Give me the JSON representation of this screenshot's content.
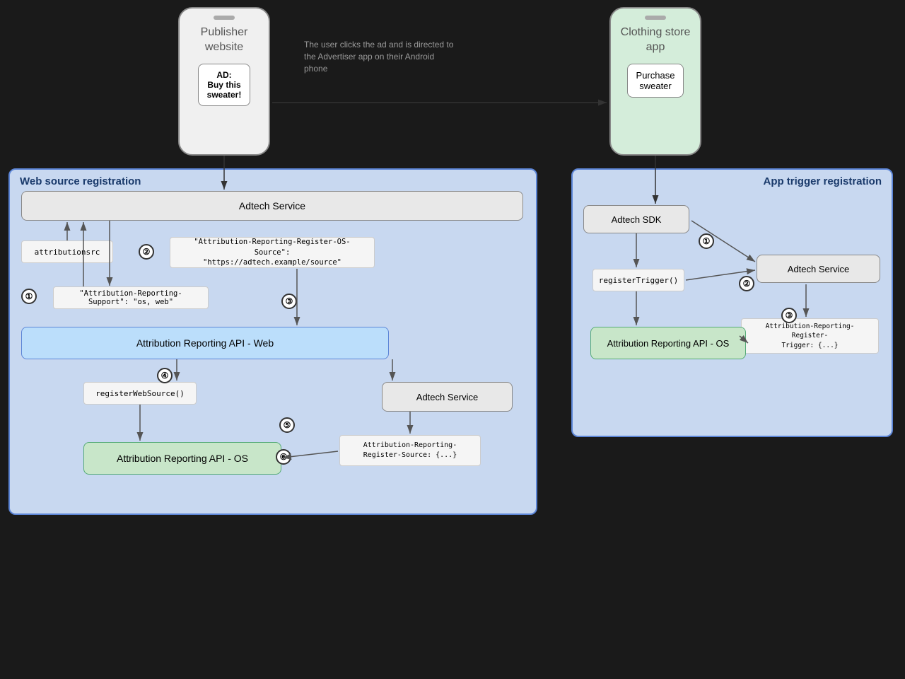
{
  "publisher_phone": {
    "title": "Publisher\nwebsite",
    "ad_label": "AD:",
    "ad_text": "Buy this\nsweater!"
  },
  "clothing_phone": {
    "title": "Clothing store\napp",
    "button": "Purchase\nsweater"
  },
  "caption": {
    "text": "The user clicks the ad and is\ndirected to the Advertiser app on\ntheir Android phone"
  },
  "web_section": {
    "title": "Web source registration"
  },
  "app_section": {
    "title": "App trigger registration"
  },
  "web_boxes": {
    "adtech_service_top": "Adtech Service",
    "attributionsrc": "attributionsrc",
    "attribution_header": "\"Attribution-Reporting-Register-OS-Source\":\n\"https://adtech.example/source\"",
    "attribution_support": "\"Attribution-Reporting-Support\": \"os, web\"",
    "attribution_api_web": "Attribution Reporting API - Web",
    "register_web_source": "registerWebSource()",
    "adtech_service_bottom": "Adtech Service",
    "attribution_register_source": "Attribution-Reporting-\nRegister-Source: {...}",
    "attribution_api_os": "Attribution Reporting API - OS"
  },
  "app_boxes": {
    "adtech_sdk": "Adtech SDK",
    "register_trigger": "registerTrigger()",
    "adtech_service": "Adtech Service",
    "attribution_api_os": "Attribution Reporting API - OS",
    "attribution_register_trigger": "Attribution-Reporting-Register-\nTrigger: {...}"
  },
  "steps": {
    "web": [
      "①",
      "②",
      "③",
      "④",
      "⑤",
      "⑥"
    ],
    "app": [
      "①",
      "②",
      "③"
    ]
  }
}
